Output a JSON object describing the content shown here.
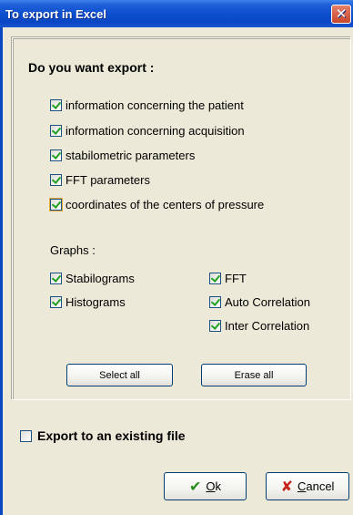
{
  "window": {
    "title": "To export in Excel",
    "close_symbol": "✕"
  },
  "group": {
    "heading": "Do you want export :",
    "options": [
      {
        "label": "information concerning the patient",
        "checked": true
      },
      {
        "label": "information concerning acquisition",
        "checked": true
      },
      {
        "label": "stabilometric parameters",
        "checked": true
      },
      {
        "label": "FFT parameters",
        "checked": true
      },
      {
        "label": "coordinates of the centers of pressure",
        "checked": true
      }
    ],
    "graphs_label": "Graphs :",
    "graphs_left": [
      {
        "label": "Stabilograms",
        "checked": true
      },
      {
        "label": "Histograms",
        "checked": true
      }
    ],
    "graphs_right": [
      {
        "label": "FFT",
        "checked": true
      },
      {
        "label": "Auto Correlation",
        "checked": true
      },
      {
        "label": "Inter Correlation",
        "checked": true
      }
    ],
    "select_all": "Select all",
    "erase_all": "Erase all"
  },
  "existing_file": {
    "label": "Export to an existing file",
    "checked": false
  },
  "buttons": {
    "ok_prefix": "",
    "ok_underline": "O",
    "ok_rest": "k",
    "cancel_underline": "C",
    "cancel_rest": "ancel"
  },
  "icons": {
    "ok": "check-icon",
    "cancel": "x-icon"
  },
  "colors": {
    "titlebar": "#0a47c4",
    "dialog_bg": "#ece9d8",
    "check": "#21a121"
  }
}
